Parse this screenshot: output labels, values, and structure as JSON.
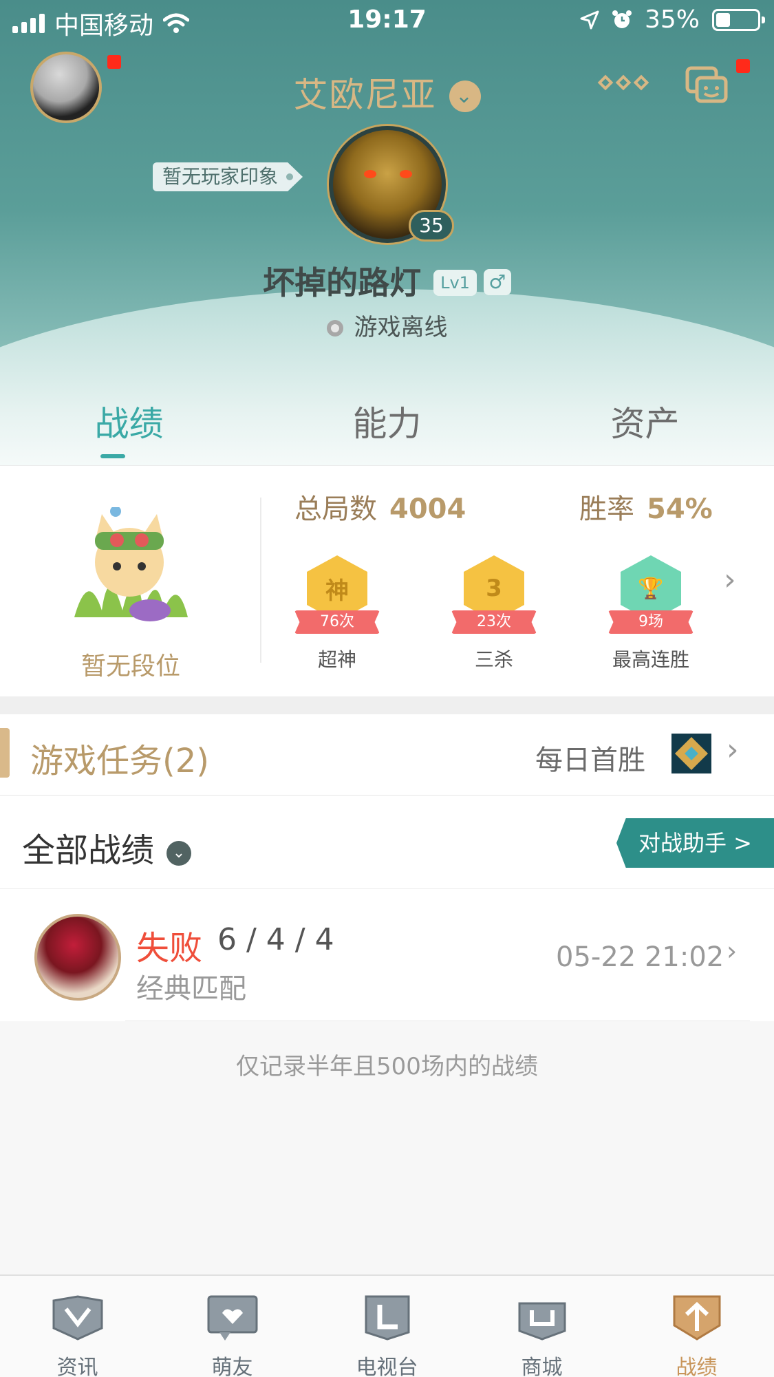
{
  "status_bar": {
    "carrier": "中国移动",
    "time": "19:17",
    "battery": "35%",
    "battery_level": 0.35
  },
  "header": {
    "server_name": "艾欧尼亚",
    "impression_tag": "暂无玩家印象",
    "hero_level": "35",
    "player_name": "坏掉的路灯",
    "player_lv": "Lv1",
    "gender_symbol": "♂",
    "online_status": "游戏离线"
  },
  "tabs": [
    {
      "label": "战绩",
      "active": true
    },
    {
      "label": "能力",
      "active": false
    },
    {
      "label": "资产",
      "active": false
    }
  ],
  "stats": {
    "rank_label": "暂无段位",
    "total_games_label": "总局数",
    "total_games_value": "4004",
    "winrate_label": "胜率",
    "winrate_value": "54%",
    "medals": [
      {
        "symbol": "神",
        "count": "76次",
        "name": "超神",
        "color": "#f5c242"
      },
      {
        "symbol": "3",
        "count": "23次",
        "name": "三杀",
        "color": "#f5c242"
      },
      {
        "symbol": "🏆",
        "count": "9场",
        "name": "最高连胜",
        "color": "#6fd6b3"
      }
    ]
  },
  "tasks": {
    "title": "游戏任务(2)",
    "daily_label": "每日首胜"
  },
  "records": {
    "title": "全部战绩",
    "assistant_label": "对战助手 >"
  },
  "match": {
    "result": "失败",
    "kda": "6 / 4 / 4",
    "mode": "经典匹配",
    "time": "05-22 21:02"
  },
  "record_note": "仅记录半年且500场内的战绩",
  "bottom_nav": [
    {
      "label": "资讯",
      "icon": "news-icon",
      "active": false
    },
    {
      "label": "萌友",
      "icon": "friends-icon",
      "active": false
    },
    {
      "label": "电视台",
      "icon": "tv-icon",
      "active": false
    },
    {
      "label": "商城",
      "icon": "shop-icon",
      "active": false
    },
    {
      "label": "战绩",
      "icon": "record-icon",
      "active": true
    }
  ],
  "colors": {
    "header_teal": "#4a8d8a",
    "gold": "#d8b784",
    "accent_teal": "#3aa9a6",
    "loss_red": "#ef4e3a"
  }
}
